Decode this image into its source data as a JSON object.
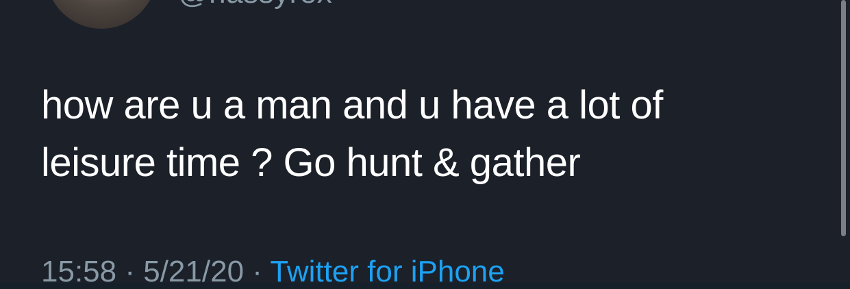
{
  "tweet": {
    "handle": "@nassyrex",
    "text_line_1": "how are u a man and u have a lot of",
    "text_line_2": "leisure time ? Go hunt & gather",
    "time": "15:58",
    "separator": "·",
    "date": "5/21/20",
    "source": "Twitter for iPhone"
  }
}
